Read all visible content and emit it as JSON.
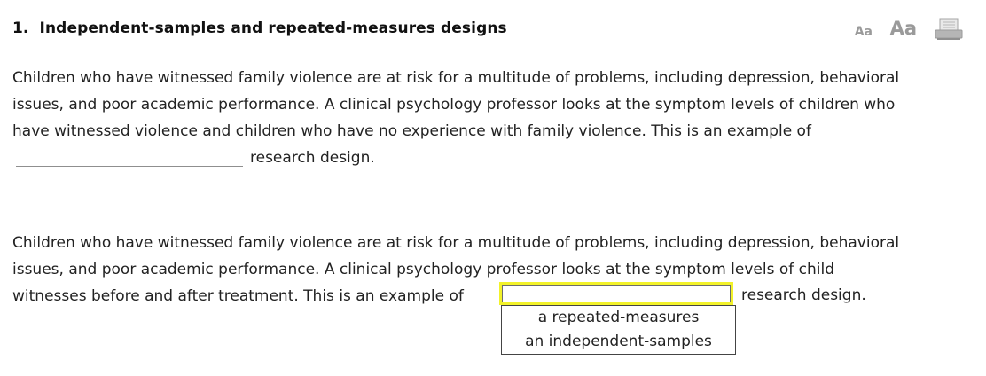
{
  "question": {
    "number": "1.",
    "title": "Independent-samples and repeated-measures designs"
  },
  "tools": {
    "font_small_label": "Aa",
    "font_large_label": "Aa",
    "print_icon": "printer-icon"
  },
  "paragraph1": {
    "line1": "Children who have witnessed family violence are at risk for a multitude of problems, including depression, behavioral",
    "line2": "issues, and poor academic performance. A clinical psychology professor looks at the symptom levels of children who",
    "line3": "have witnessed violence and children who have no experience with family violence. This is an example of",
    "blank_value": "",
    "line4_suffix": "research design."
  },
  "paragraph2": {
    "line1": "Children who have witnessed family violence are at risk for a multitude of problems, including depression, behavioral",
    "line2": "issues, and poor academic performance. A clinical psychology professor looks at the symptom levels of child",
    "line3_prefix": "witnesses before and after treatment. This is an example of",
    "line3_suffix": "research design."
  },
  "dropdown": {
    "selected": "",
    "options": [
      "a repeated-measures",
      "an independent-samples"
    ],
    "highlight_color": "#f2f22a"
  }
}
